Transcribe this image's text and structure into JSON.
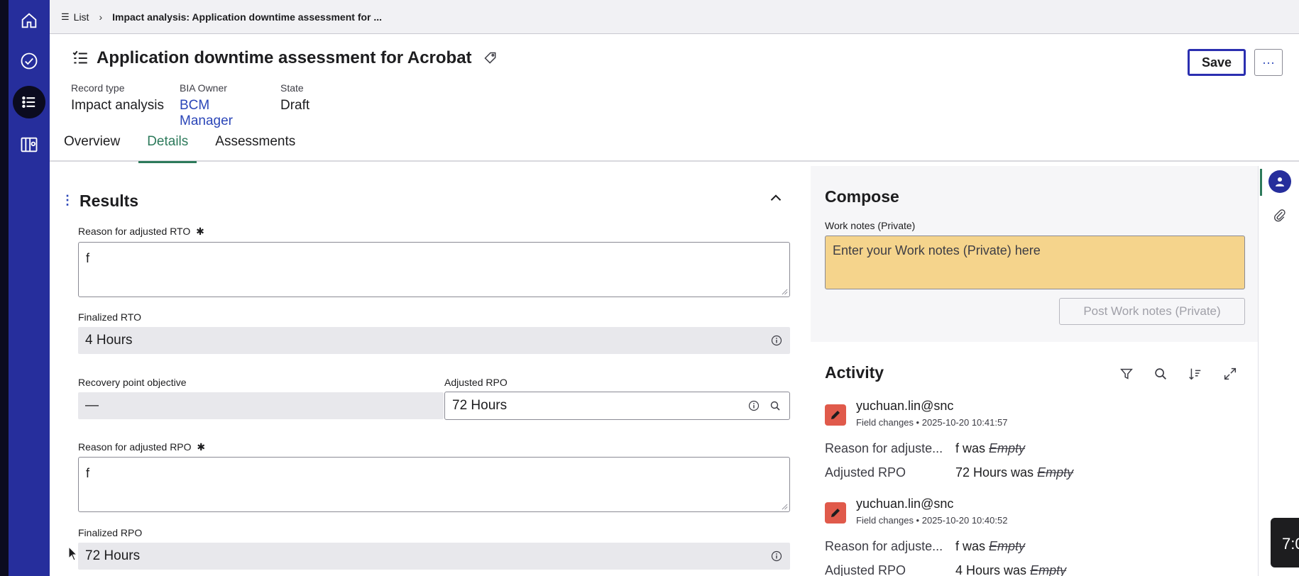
{
  "breadcrumb": {
    "list_label": "List",
    "current": "Impact analysis: Application downtime assessment for ..."
  },
  "header": {
    "title": "Application downtime assessment for Acrobat",
    "record_type_label": "Record type",
    "record_type_value": "Impact analysis",
    "owner_label": "BIA Owner",
    "owner_value": "BCM Manager",
    "state_label": "State",
    "state_value": "Draft",
    "save_label": "Save",
    "more_label": "···"
  },
  "tabs": [
    {
      "label": "Overview"
    },
    {
      "label": "Details"
    },
    {
      "label": "Assessments"
    }
  ],
  "results": {
    "title": "Results",
    "reason_rto_label": "Reason for adjusted RTO",
    "reason_rto_value": "f",
    "finalized_rto_label": "Finalized RTO",
    "finalized_rto_value": "4 Hours",
    "rpo_label": "Recovery point objective",
    "rpo_value": "—",
    "adjusted_rpo_label": "Adjusted RPO",
    "adjusted_rpo_value": "72 Hours",
    "reason_rpo_label": "Reason for adjusted RPO",
    "reason_rpo_value": "f",
    "finalized_rpo_label": "Finalized RPO",
    "finalized_rpo_value": "72 Hours",
    "required_mark": "✱"
  },
  "compose": {
    "title": "Compose",
    "work_notes_label": "Work notes (Private)",
    "work_notes_placeholder": "Enter your Work notes (Private) here",
    "post_label": "Post Work notes (Private)"
  },
  "activity": {
    "title": "Activity",
    "entries": [
      {
        "user": "yuchuan.lin@snc",
        "meta": "Field changes • 2025-10-20 10:41:57",
        "changes": [
          {
            "field": "Reason for adjuste...",
            "new": "f was",
            "old": "Empty"
          },
          {
            "field": "Adjusted RPO",
            "new": "72 Hours was",
            "old": "Empty"
          }
        ]
      },
      {
        "user": "yuchuan.lin@snc",
        "meta": "Field changes • 2025-10-20 10:40:52",
        "changes": [
          {
            "field": "Reason for adjuste...",
            "new": "f was",
            "old": "Empty"
          },
          {
            "field": "Adjusted RPO",
            "new": "4 Hours was",
            "old": "Empty"
          }
        ]
      }
    ]
  },
  "clock": "7:0",
  "colors": {
    "nav": "#262e9c",
    "accent_tab": "#2d7a5b",
    "link": "#2b46b8",
    "work_notes_bg": "#f5d48c",
    "avatar": "#e05a4b"
  }
}
